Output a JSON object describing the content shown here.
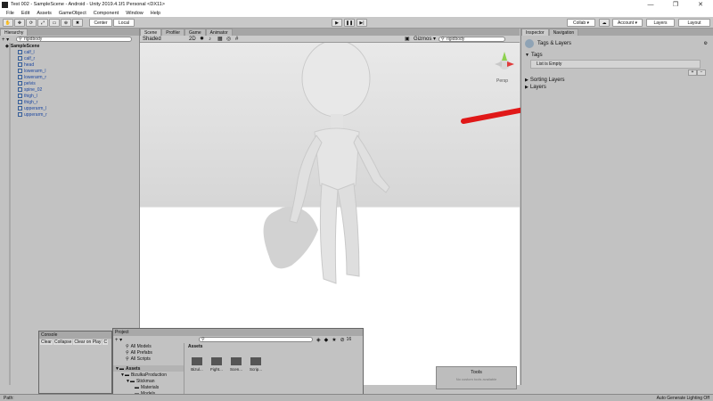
{
  "window": {
    "title": "Test 002 - SampleScene - Android - Unity 2019.4.1f1 Personal <DX11>",
    "minimize": "—",
    "maximize": "❐",
    "close": "✕"
  },
  "menu": [
    "File",
    "Edit",
    "Assets",
    "GameObject",
    "Component",
    "Window",
    "Help"
  ],
  "toolbar": {
    "pivot_label": "Center",
    "space_label": "Local",
    "collab_label": "Collab ▾",
    "account_label": "Account ▾",
    "layers_label": "Layers",
    "layout_label": "Layout"
  },
  "hierarchy": {
    "tab": "Hierarchy",
    "add": "+ ▾",
    "search": "rigidbody",
    "scene": "SampleScene",
    "items": [
      "calf_l",
      "calf_r",
      "head",
      "lowerarm_l",
      "lowerarm_r",
      "pelvis",
      "spine_02",
      "thigh_l",
      "thigh_r",
      "upperarm_l",
      "upperarm_r"
    ]
  },
  "scene": {
    "tabs": [
      "Scene",
      "Profiler",
      "Game",
      "Animator"
    ],
    "shading": "Shaded",
    "twod": "2D",
    "gizmos": "Gizmos ▾",
    "search": "rigidbody",
    "persp": "Persp"
  },
  "inspector": {
    "tabs": [
      "Inspector",
      "Navigation"
    ],
    "header": "Tags & Layers",
    "tags_label": "Tags",
    "list_empty": "List is Empty",
    "sorting_layers": "Sorting Layers",
    "layers": "Layers",
    "add_btn": "+",
    "remove_btn": "−"
  },
  "console": {
    "tab": "Console",
    "buttons": [
      "Clear",
      "Collapse",
      "Clear on Play",
      "C"
    ]
  },
  "project": {
    "tab": "Project",
    "add": "+ ▾",
    "favorites": [
      "All Models",
      "All Prefabs",
      "All Scripts"
    ],
    "tree": [
      "Assets",
      "BizulkaProduction",
      "Stickman",
      "Materials",
      "Models"
    ],
    "breadcrumb": "Assets",
    "folders": [
      "Bizul...",
      "Fight...",
      "Scen...",
      "Scrip..."
    ],
    "badge": "16"
  },
  "tools": {
    "title": "Tools",
    "empty": "No custom tools available"
  },
  "status": {
    "path": "Path:",
    "lighting": "Auto Generate Lighting Off"
  },
  "colors": {
    "arrow": "#e01818",
    "selection_blue": "#1c47a0",
    "gizmo_green": "#8ed14f",
    "gizmo_red": "#e03b3b"
  }
}
